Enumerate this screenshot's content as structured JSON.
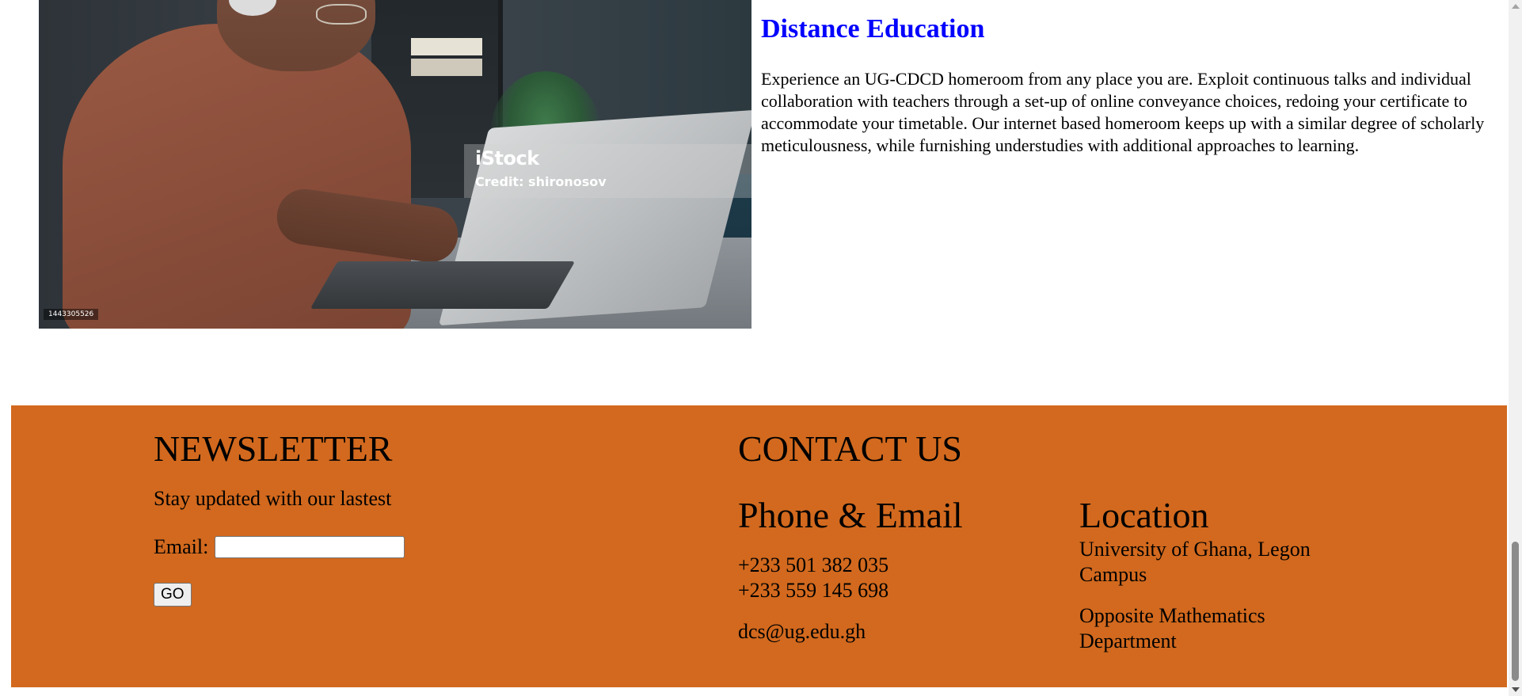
{
  "hero": {
    "watermark_brand": "iStock",
    "watermark_credit": "Credit: shironosov",
    "photo_id": "1443305526"
  },
  "article": {
    "title": "Distance Education",
    "body": "Experience an UG-CDCD homeroom from any place you are. Exploit continuous talks and individual collaboration with teachers through a set-up of online conveyance choices, redoing your certificate to accommodate your timetable. Our internet based homeroom keeps up with a similar degree of scholarly meticulousness, while furnishing understudies with additional approaches to learning."
  },
  "footer": {
    "background_color": "#d2691e",
    "newsletter": {
      "heading": "NEWSLETTER",
      "text": "Stay updated with our lastest",
      "email_label": "Email:",
      "email_value": "",
      "button_label": "GO"
    },
    "contact": {
      "heading": "CONTACT US",
      "phone_email": {
        "heading": "Phone & Email",
        "phone_1": "+233 501 382 035",
        "phone_2": "+233 559 145 698",
        "email": "dcs@ug.edu.gh"
      },
      "location": {
        "heading": "Location",
        "line_1": "University of Ghana, Legon Campus",
        "line_2": "Opposite Mathematics Department"
      }
    }
  },
  "colors": {
    "title": "#0000ff",
    "footer": "#d2691e"
  },
  "icons": {
    "scroll_up": "scroll-up-arrow-icon",
    "scroll_down": "scroll-down-arrow-icon"
  }
}
